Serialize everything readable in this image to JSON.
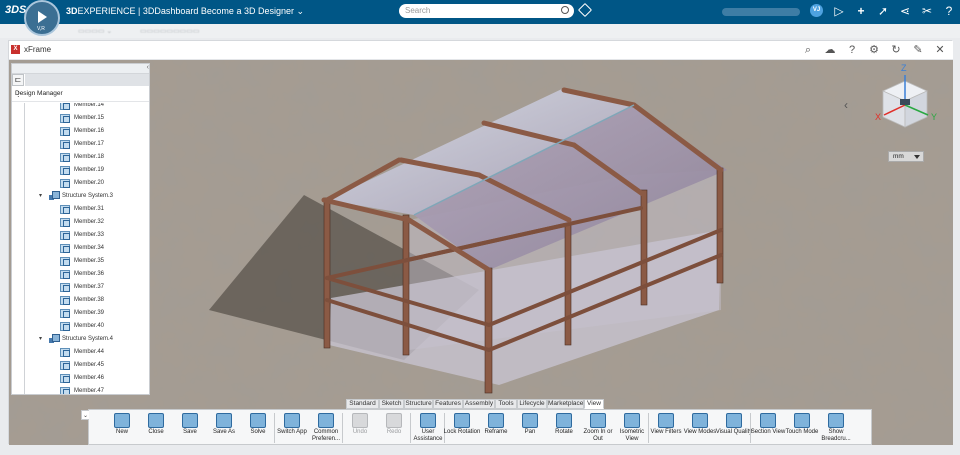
{
  "topbar": {
    "brand_logo": "3DS",
    "brand_bold": "3D",
    "brand_rest": "EXPERIENCE | 3DDashboard",
    "dashboard_name": "Become a 3D Designer ⌄",
    "compass_version": "V,R",
    "search_placeholder": "Search",
    "avatar_initials": "VJ",
    "icons": [
      "search-icon",
      "tag-icon",
      "play-icon",
      "add-icon",
      "share-icon",
      "network-icon",
      "tools-icon",
      "help-icon"
    ]
  },
  "app": {
    "title": "xFrame",
    "window_icons": [
      "search-icon",
      "cloud-icon",
      "help-icon",
      "gear-icon",
      "refresh-icon",
      "pin-icon",
      "close-icon"
    ]
  },
  "tree": {
    "header": "Design Manager",
    "items": [
      {
        "label": "Member.14",
        "type": "member"
      },
      {
        "label": "Member.15",
        "type": "member"
      },
      {
        "label": "Member.16",
        "type": "member"
      },
      {
        "label": "Member.17",
        "type": "member"
      },
      {
        "label": "Member.18",
        "type": "member"
      },
      {
        "label": "Member.19",
        "type": "member"
      },
      {
        "label": "Member.20",
        "type": "member"
      },
      {
        "label": "Structure System.3",
        "type": "system"
      },
      {
        "label": "Member.31",
        "type": "member"
      },
      {
        "label": "Member.32",
        "type": "member"
      },
      {
        "label": "Member.33",
        "type": "member"
      },
      {
        "label": "Member.34",
        "type": "member"
      },
      {
        "label": "Member.35",
        "type": "member"
      },
      {
        "label": "Member.36",
        "type": "member"
      },
      {
        "label": "Member.37",
        "type": "member"
      },
      {
        "label": "Member.38",
        "type": "member"
      },
      {
        "label": "Member.39",
        "type": "member"
      },
      {
        "label": "Member.40",
        "type": "member"
      },
      {
        "label": "Structure System.4",
        "type": "system"
      },
      {
        "label": "Member.44",
        "type": "member"
      },
      {
        "label": "Member.45",
        "type": "member"
      },
      {
        "label": "Member.46",
        "type": "member"
      },
      {
        "label": "Member.47",
        "type": "member"
      }
    ]
  },
  "viewport": {
    "units": "mm",
    "axes": {
      "x": "X",
      "y": "Y",
      "z": "Z"
    },
    "colors": {
      "x": "#e0302a",
      "y": "#2aa842",
      "z": "#3a7fd6",
      "roof": "#b9b2c6",
      "beam": "#8b5a45"
    }
  },
  "action_tabs": [
    "Standard",
    "Sketch",
    "Structure",
    "Features",
    "Assembly",
    "Tools",
    "Lifecycle",
    "Marketplace",
    "View"
  ],
  "active_tab": "View",
  "actions": [
    {
      "label": "New",
      "icon": "new-icon",
      "enabled": true
    },
    {
      "label": "Close",
      "icon": "close-doc-icon",
      "enabled": true
    },
    {
      "label": "Save",
      "icon": "save-icon",
      "enabled": true
    },
    {
      "label": "Save As",
      "icon": "save-as-icon",
      "enabled": true
    },
    {
      "label": "Solve",
      "icon": "solve-icon",
      "enabled": true
    },
    {
      "label": "Switch App",
      "icon": "switch-app-icon",
      "enabled": true
    },
    {
      "label": "Common Preferen...",
      "icon": "preferences-icon",
      "enabled": true
    },
    {
      "label": "Undo",
      "icon": "undo-icon",
      "enabled": false
    },
    {
      "label": "Redo",
      "icon": "redo-icon",
      "enabled": false
    },
    {
      "label": "User Assistance",
      "icon": "help-icon",
      "enabled": true
    },
    {
      "label": "Lock Rotation",
      "icon": "lock-icon",
      "enabled": true
    },
    {
      "label": "Reframe",
      "icon": "reframe-icon",
      "enabled": true
    },
    {
      "label": "Pan",
      "icon": "pan-icon",
      "enabled": true
    },
    {
      "label": "Rotate",
      "icon": "rotate-icon",
      "enabled": true
    },
    {
      "label": "Zoom In or Out",
      "icon": "zoom-icon",
      "enabled": true
    },
    {
      "label": "Isometric View",
      "icon": "isometric-icon",
      "enabled": true
    },
    {
      "label": "View Filters",
      "icon": "view-filters-icon",
      "enabled": true
    },
    {
      "label": "View Modes",
      "icon": "view-modes-icon",
      "enabled": true
    },
    {
      "label": "Visual Quality",
      "icon": "visual-quality-icon",
      "enabled": true
    },
    {
      "label": "Section View",
      "icon": "section-icon",
      "enabled": true
    },
    {
      "label": "Touch Mode",
      "icon": "touch-icon",
      "enabled": true
    },
    {
      "label": "Show Breadcru...",
      "icon": "breadcrumb-icon",
      "enabled": true
    }
  ]
}
